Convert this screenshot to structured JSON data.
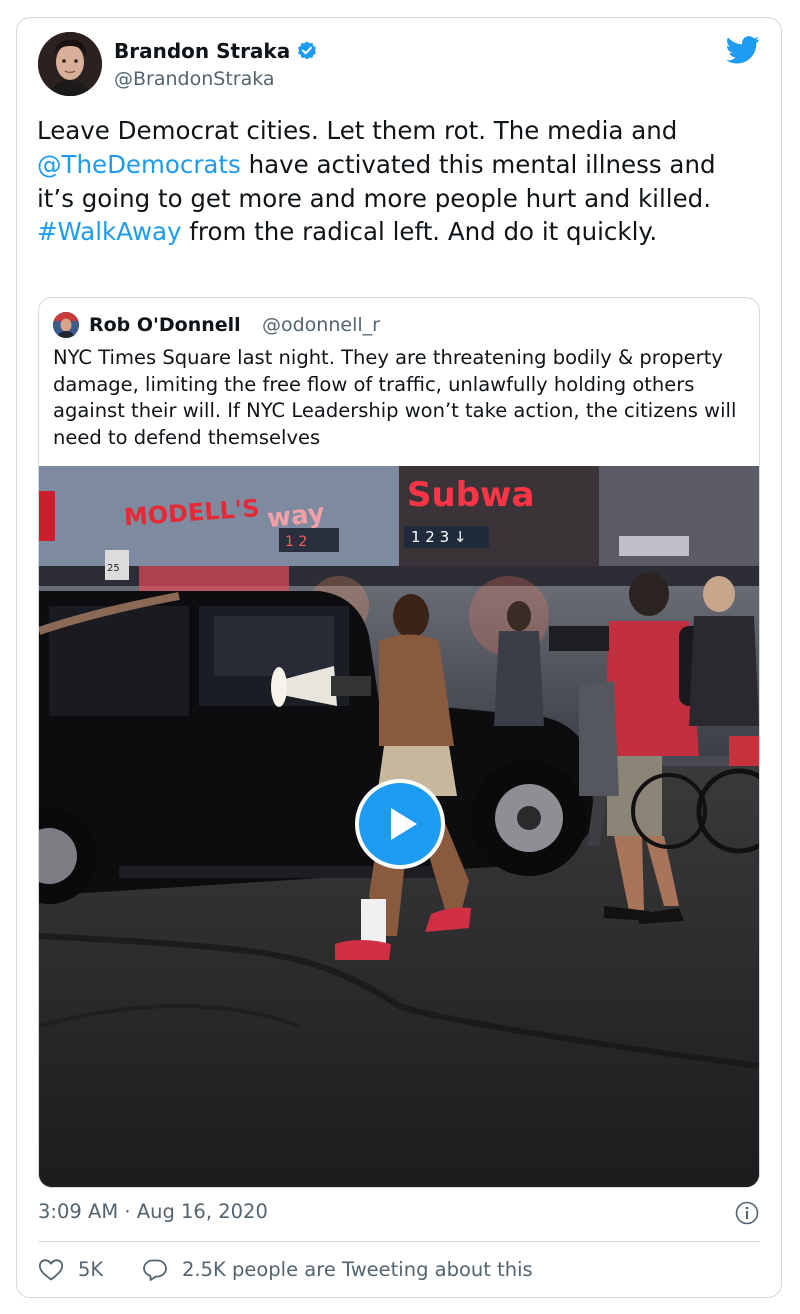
{
  "author": {
    "name": "Brandon Straka",
    "handle": "@BrandonStraka",
    "verified": true,
    "avatar_icon": "profile-photo"
  },
  "tweet": {
    "segments": [
      {
        "text": "Leave Democrat cities. Let them rot. The media and ",
        "type": "text"
      },
      {
        "text": "@TheDemocrats",
        "type": "mention"
      },
      {
        "text": " have activated this mental illness and it’s going to get more and more people hurt and killed. ",
        "type": "text"
      },
      {
        "text": "#WalkAway",
        "type": "hashtag"
      },
      {
        "text": " from the radical left. And do it quickly.",
        "type": "text"
      }
    ]
  },
  "quoted": {
    "name": "Rob O'Donnell",
    "handle": "@odonnell_r",
    "text": "NYC Times Square last night. They are threatening bodily & property damage, limiting the free flow of traffic, unlawfully holding others against their will. If NYC Leadership won’t take action, the citizens will need to defend themselves",
    "media": {
      "type": "video",
      "signs": {
        "store": "MODELL'S",
        "subway_left": "Subway",
        "subway_right": "Subwa",
        "lines": "1 2 3 ↓",
        "speed": "25"
      }
    }
  },
  "meta": {
    "timestamp": "3:09 AM · Aug 16, 2020"
  },
  "engagement": {
    "likes": "5K",
    "conversation": "2.5K people are Tweeting about this"
  },
  "colors": {
    "link": "#1d9bf0",
    "secondary_text": "#536471",
    "border": "#cfd9de",
    "twitter_blue": "#1d9bf0"
  }
}
